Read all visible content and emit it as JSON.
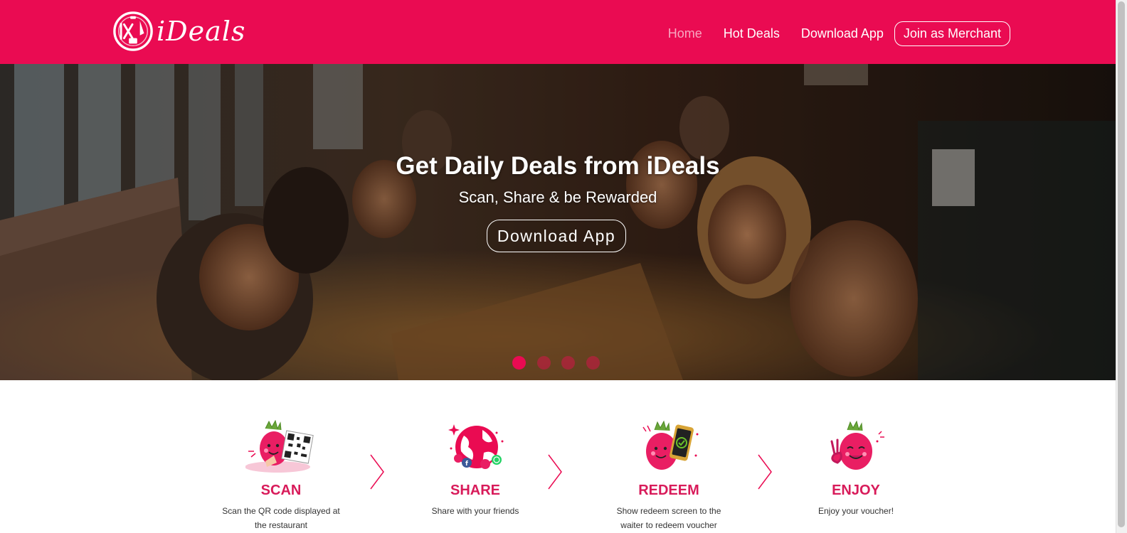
{
  "brand": {
    "name": "iDeals",
    "primary_color": "#ea0b52",
    "accent_color": "#d81b5a"
  },
  "nav": {
    "items": [
      {
        "label": "Home",
        "active": true
      },
      {
        "label": "Hot Deals",
        "active": false
      },
      {
        "label": "Download App",
        "active": false
      }
    ],
    "merchant_button": "Join as Merchant"
  },
  "hero": {
    "title": "Get Daily Deals from iDeals",
    "subtitle": "Scan, Share & be Rewarded",
    "button": "Download App",
    "slide_count": 4,
    "active_slide": 0
  },
  "steps": [
    {
      "title": "SCAN",
      "desc": "Scan the QR code displayed at the restaurant",
      "icon": "scan-qr-mascot-icon"
    },
    {
      "title": "SHARE",
      "desc": "Share with your friends",
      "icon": "share-globe-mascot-icon"
    },
    {
      "title": "REDEEM",
      "desc": "Show redeem screen to the waiter to redeem voucher",
      "icon": "redeem-phone-mascot-icon"
    },
    {
      "title": "ENJOY",
      "desc": "Enjoy your voucher!",
      "icon": "enjoy-mascot-icon"
    }
  ]
}
